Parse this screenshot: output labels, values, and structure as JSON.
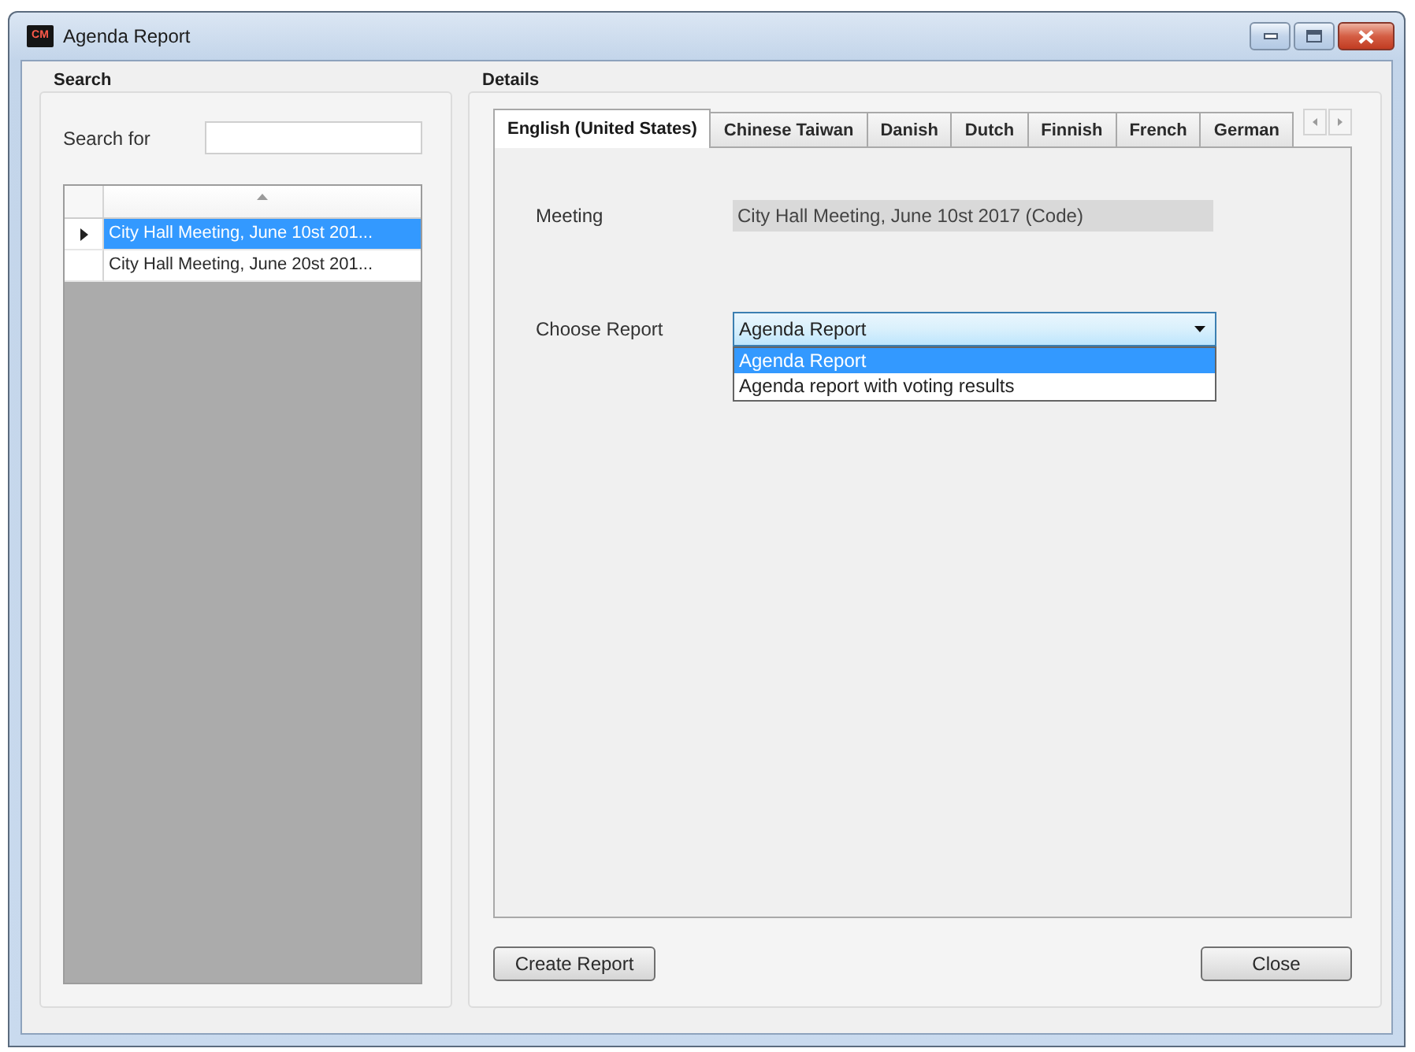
{
  "window": {
    "logo": "CM",
    "title": "Agenda Report"
  },
  "search": {
    "title": "Search",
    "label": "Search for",
    "results": [
      {
        "text": "City Hall Meeting, June 10st 201...",
        "selected": true
      },
      {
        "text": "City Hall Meeting, June 20st 201...",
        "selected": false
      }
    ]
  },
  "details": {
    "title": "Details",
    "tabs": [
      {
        "label": "English (United States)",
        "selected": true
      },
      {
        "label": "Chinese Taiwan",
        "selected": false
      },
      {
        "label": "Danish",
        "selected": false
      },
      {
        "label": "Dutch",
        "selected": false
      },
      {
        "label": "Finnish",
        "selected": false
      },
      {
        "label": "French",
        "selected": false
      },
      {
        "label": "German",
        "selected": false
      }
    ],
    "meeting": {
      "label": "Meeting",
      "value": "City Hall Meeting, June 10st 2017 (Code)"
    },
    "report": {
      "label": "Choose Report",
      "value": "Agenda Report",
      "expanded": true,
      "options": [
        {
          "label": "Agenda Report",
          "selected": true
        },
        {
          "label": "Agenda report with voting results",
          "selected": false
        }
      ]
    }
  },
  "buttons": {
    "create": "Create Report",
    "close": "Close"
  }
}
